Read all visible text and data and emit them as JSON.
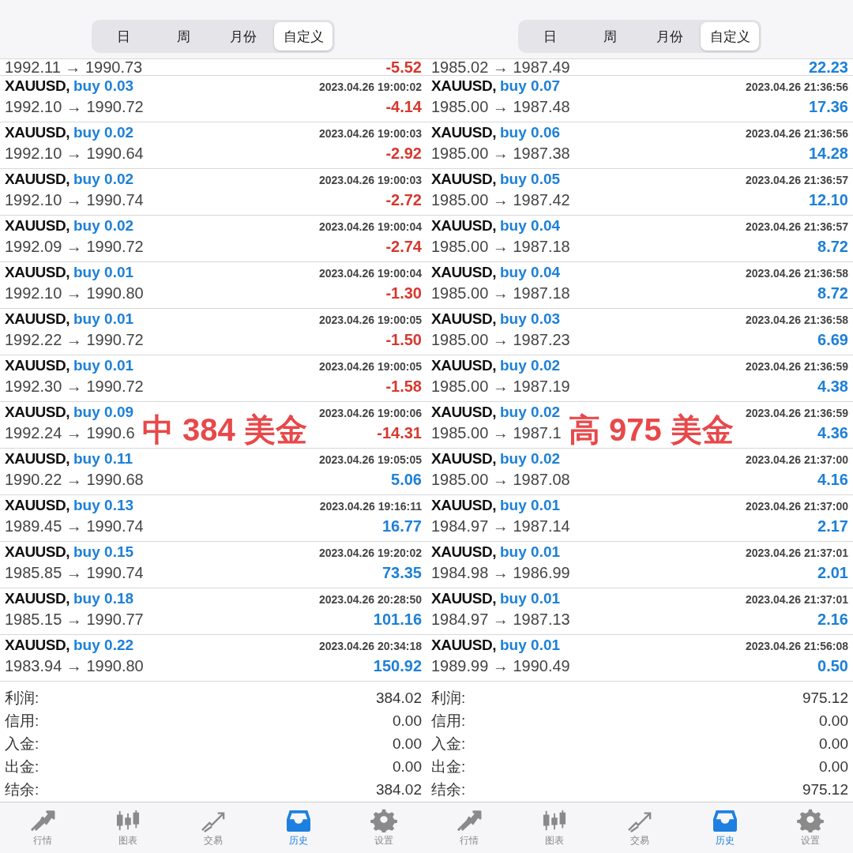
{
  "panels": [
    {
      "segments": [
        {
          "label": "日",
          "selected": false
        },
        {
          "label": "周",
          "selected": false
        },
        {
          "label": "月份",
          "selected": false
        },
        {
          "label": "自定义",
          "selected": true
        }
      ],
      "partial_row": {
        "prices": "1992.11 → 1990.73",
        "profit": "-5.52",
        "loss": true
      },
      "trades": [
        {
          "symbol": "XAUUSD,",
          "order": "buy 0.03",
          "time": "2023.04.26 19:00:02",
          "prices": "1992.10 → 1990.72",
          "profit": "-4.14",
          "loss": true
        },
        {
          "symbol": "XAUUSD,",
          "order": "buy 0.02",
          "time": "2023.04.26 19:00:03",
          "prices": "1992.10 → 1990.64",
          "profit": "-2.92",
          "loss": true
        },
        {
          "symbol": "XAUUSD,",
          "order": "buy 0.02",
          "time": "2023.04.26 19:00:03",
          "prices": "1992.10 → 1990.74",
          "profit": "-2.72",
          "loss": true
        },
        {
          "symbol": "XAUUSD,",
          "order": "buy 0.02",
          "time": "2023.04.26 19:00:04",
          "prices": "1992.09 → 1990.72",
          "profit": "-2.74",
          "loss": true
        },
        {
          "symbol": "XAUUSD,",
          "order": "buy 0.01",
          "time": "2023.04.26 19:00:04",
          "prices": "1992.10 → 1990.80",
          "profit": "-1.30",
          "loss": true
        },
        {
          "symbol": "XAUUSD,",
          "order": "buy 0.01",
          "time": "2023.04.26 19:00:05",
          "prices": "1992.22 → 1990.72",
          "profit": "-1.50",
          "loss": true
        },
        {
          "symbol": "XAUUSD,",
          "order": "buy 0.01",
          "time": "2023.04.26 19:00:05",
          "prices": "1992.30 → 1990.72",
          "profit": "-1.58",
          "loss": true
        },
        {
          "symbol": "XAUUSD,",
          "order": "buy 0.09",
          "time": "2023.04.26 19:00:06",
          "prices": "1992.24 → 1990.6",
          "profit": "-14.31",
          "loss": true
        },
        {
          "symbol": "XAUUSD,",
          "order": "buy 0.11",
          "time": "2023.04.26 19:05:05",
          "prices": "1990.22 → 1990.68",
          "profit": "5.06",
          "loss": false
        },
        {
          "symbol": "XAUUSD,",
          "order": "buy 0.13",
          "time": "2023.04.26 19:16:11",
          "prices": "1989.45 → 1990.74",
          "profit": "16.77",
          "loss": false
        },
        {
          "symbol": "XAUUSD,",
          "order": "buy 0.15",
          "time": "2023.04.26 19:20:02",
          "prices": "1985.85 → 1990.74",
          "profit": "73.35",
          "loss": false
        },
        {
          "symbol": "XAUUSD,",
          "order": "buy 0.18",
          "time": "2023.04.26 20:28:50",
          "prices": "1985.15 → 1990.77",
          "profit": "101.16",
          "loss": false
        },
        {
          "symbol": "XAUUSD,",
          "order": "buy 0.22",
          "time": "2023.04.26 20:34:18",
          "prices": "1983.94 → 1990.80",
          "profit": "150.92",
          "loss": false
        }
      ],
      "summary": [
        {
          "label": "利润:",
          "value": "384.02"
        },
        {
          "label": "信用:",
          "value": "0.00"
        },
        {
          "label": "入金:",
          "value": "0.00"
        },
        {
          "label": "出金:",
          "value": "0.00"
        },
        {
          "label": "结余:",
          "value": "384.02"
        }
      ],
      "annotation": "中 384 美金",
      "tabbar": [
        {
          "label": "行情",
          "kind": "quotes",
          "selected": false
        },
        {
          "label": "图表",
          "kind": "chart",
          "selected": false
        },
        {
          "label": "交易",
          "kind": "trade",
          "selected": false
        },
        {
          "label": "历史",
          "kind": "history",
          "selected": true
        },
        {
          "label": "设置",
          "kind": "settings",
          "selected": false
        }
      ]
    },
    {
      "segments": [
        {
          "label": "日",
          "selected": false
        },
        {
          "label": "周",
          "selected": false
        },
        {
          "label": "月份",
          "selected": false
        },
        {
          "label": "自定义",
          "selected": true
        }
      ],
      "partial_row": {
        "prices": "1985.02 → 1987.49",
        "profit": "22.23",
        "loss": false
      },
      "trades": [
        {
          "symbol": "XAUUSD,",
          "order": "buy 0.07",
          "time": "2023.04.26 21:36:56",
          "prices": "1985.00 → 1987.48",
          "profit": "17.36",
          "loss": false
        },
        {
          "symbol": "XAUUSD,",
          "order": "buy 0.06",
          "time": "2023.04.26 21:36:56",
          "prices": "1985.00 → 1987.38",
          "profit": "14.28",
          "loss": false
        },
        {
          "symbol": "XAUUSD,",
          "order": "buy 0.05",
          "time": "2023.04.26 21:36:57",
          "prices": "1985.00 → 1987.42",
          "profit": "12.10",
          "loss": false
        },
        {
          "symbol": "XAUUSD,",
          "order": "buy 0.04",
          "time": "2023.04.26 21:36:57",
          "prices": "1985.00 → 1987.18",
          "profit": "8.72",
          "loss": false
        },
        {
          "symbol": "XAUUSD,",
          "order": "buy 0.04",
          "time": "2023.04.26 21:36:58",
          "prices": "1985.00 → 1987.18",
          "profit": "8.72",
          "loss": false
        },
        {
          "symbol": "XAUUSD,",
          "order": "buy 0.03",
          "time": "2023.04.26 21:36:58",
          "prices": "1985.00 → 1987.23",
          "profit": "6.69",
          "loss": false
        },
        {
          "symbol": "XAUUSD,",
          "order": "buy 0.02",
          "time": "2023.04.26 21:36:59",
          "prices": "1985.00 → 1987.19",
          "profit": "4.38",
          "loss": false
        },
        {
          "symbol": "XAUUSD,",
          "order": "buy 0.02",
          "time": "2023.04.26 21:36:59",
          "prices": "1985.00 → 1987.1",
          "profit": "4.36",
          "loss": false
        },
        {
          "symbol": "XAUUSD,",
          "order": "buy 0.02",
          "time": "2023.04.26 21:37:00",
          "prices": "1985.00 → 1987.08",
          "profit": "4.16",
          "loss": false
        },
        {
          "symbol": "XAUUSD,",
          "order": "buy 0.01",
          "time": "2023.04.26 21:37:00",
          "prices": "1984.97 → 1987.14",
          "profit": "2.17",
          "loss": false
        },
        {
          "symbol": "XAUUSD,",
          "order": "buy 0.01",
          "time": "2023.04.26 21:37:01",
          "prices": "1984.98 → 1986.99",
          "profit": "2.01",
          "loss": false
        },
        {
          "symbol": "XAUUSD,",
          "order": "buy 0.01",
          "time": "2023.04.26 21:37:01",
          "prices": "1984.97 → 1987.13",
          "profit": "2.16",
          "loss": false
        },
        {
          "symbol": "XAUUSD,",
          "order": "buy 0.01",
          "time": "2023.04.26 21:56:08",
          "prices": "1989.99 → 1990.49",
          "profit": "0.50",
          "loss": false
        }
      ],
      "summary": [
        {
          "label": "利润:",
          "value": "975.12"
        },
        {
          "label": "信用:",
          "value": "0.00"
        },
        {
          "label": "入金:",
          "value": "0.00"
        },
        {
          "label": "出金:",
          "value": "0.00"
        },
        {
          "label": "结余:",
          "value": "975.12"
        }
      ],
      "annotation": "高 975 美金",
      "tabbar": [
        {
          "label": "行情",
          "kind": "quotes",
          "selected": false
        },
        {
          "label": "图表",
          "kind": "chart",
          "selected": false
        },
        {
          "label": "交易",
          "kind": "trade",
          "selected": false
        },
        {
          "label": "历史",
          "kind": "history",
          "selected": true
        },
        {
          "label": "设置",
          "kind": "settings",
          "selected": false
        }
      ]
    }
  ]
}
